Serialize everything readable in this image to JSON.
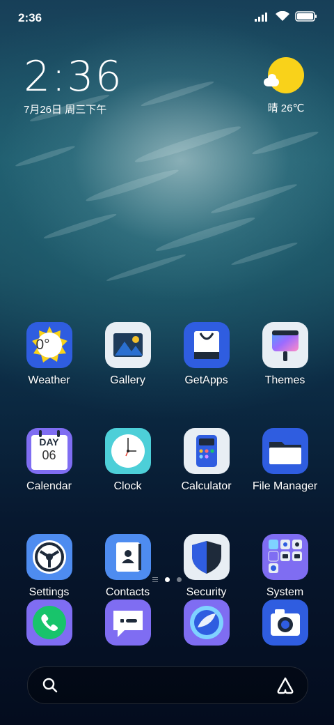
{
  "status_bar": {
    "time": "2:36",
    "icons": [
      "signal-icon",
      "wifi-icon",
      "battery-icon"
    ]
  },
  "clock_widget": {
    "time": "2:36",
    "date": "7月26日 周三下午"
  },
  "weather_widget": {
    "condition_icon": "sun-cloud-icon",
    "text": "晴 26℃"
  },
  "apps": {
    "row1": [
      {
        "label": "Weather",
        "icon": "weather-icon"
      },
      {
        "label": "Gallery",
        "icon": "gallery-icon"
      },
      {
        "label": "GetApps",
        "icon": "getapps-icon"
      },
      {
        "label": "Themes",
        "icon": "themes-icon"
      }
    ],
    "row2": [
      {
        "label": "Calendar",
        "icon": "calendar-icon",
        "badge_top": "DAY",
        "badge_num": "06"
      },
      {
        "label": "Clock",
        "icon": "clock-icon"
      },
      {
        "label": "Calculator",
        "icon": "calculator-icon"
      },
      {
        "label": "File Manager",
        "icon": "folder-icon"
      }
    ],
    "row3": [
      {
        "label": "Settings",
        "icon": "settings-icon"
      },
      {
        "label": "Contacts",
        "icon": "contacts-icon"
      },
      {
        "label": "Security",
        "icon": "security-icon"
      },
      {
        "label": "System",
        "icon": "system-folder-icon"
      }
    ]
  },
  "weather_icon_text": "0°",
  "page_indicator": {
    "pages": 2,
    "active": 0
  },
  "dock": [
    "phone-icon",
    "messages-icon",
    "browser-icon",
    "camera-icon"
  ],
  "colors": {
    "sun": "#f9d21a",
    "blue": "#2f5de0",
    "purple": "#7f6df2",
    "green": "#18c46b"
  }
}
